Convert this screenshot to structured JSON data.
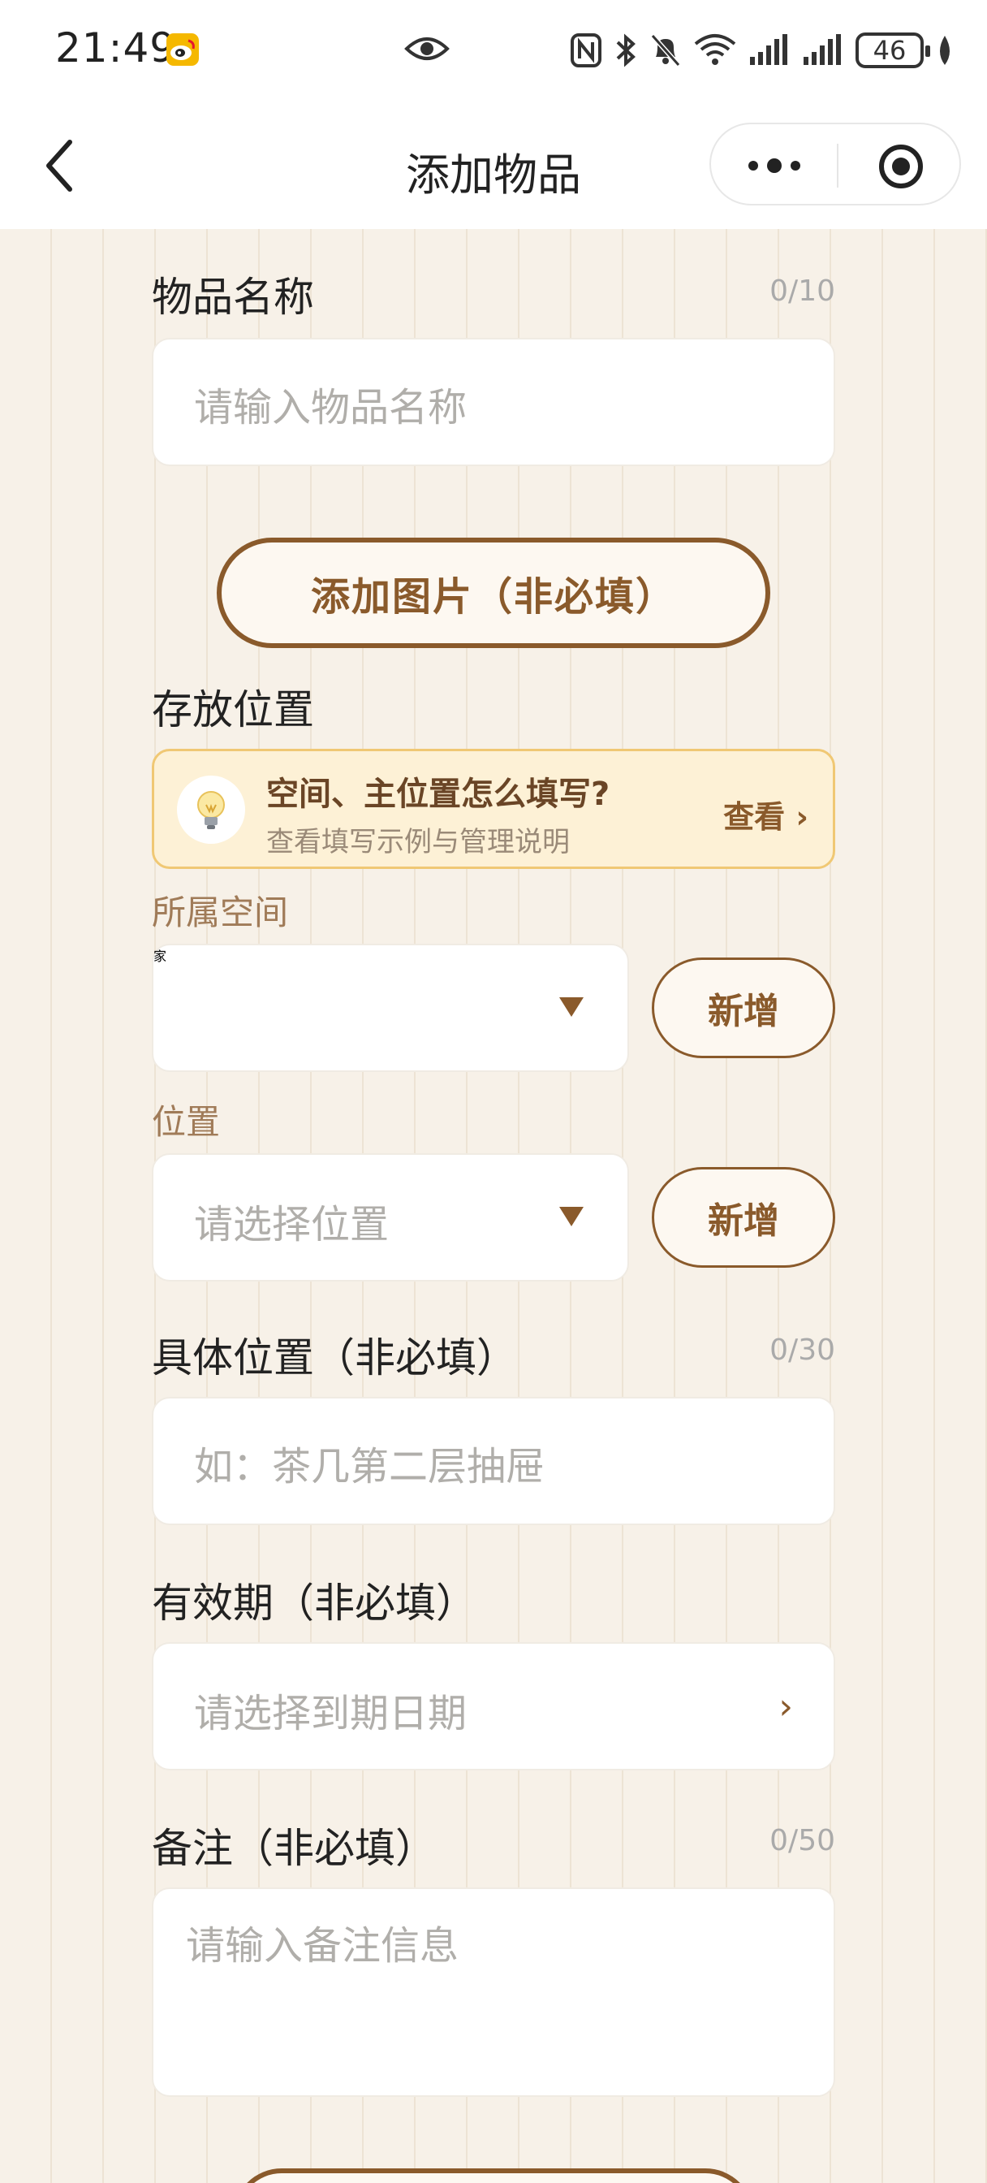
{
  "status_bar": {
    "time": "21:49",
    "battery": "46",
    "icons": [
      "weibo-icon",
      "eye-icon",
      "nfc-icon",
      "bluetooth-icon",
      "mute-icon",
      "wifi-icon",
      "signal-icon",
      "signal-icon-2",
      "leaf-icon"
    ]
  },
  "nav": {
    "title": "添加物品",
    "back_icon": "back-icon",
    "more_icon": "more-icon",
    "target_icon": "target-icon"
  },
  "form": {
    "name": {
      "label": "物品名称",
      "counter": "0/10",
      "placeholder": "请输入物品名称"
    },
    "photo_button": "添加图片（非必填）",
    "storage": {
      "label": "存放位置",
      "tip_title": "空间、主位置怎么填写?",
      "tip_desc": "查看填写示例与管理说明",
      "tip_link": "查看 ›",
      "space_label": "所属空间",
      "space_value": "家",
      "space_add": "新增",
      "location_label": "位置",
      "location_placeholder": "请选择位置",
      "location_add": "新增"
    },
    "detail": {
      "label": "具体位置（非必填）",
      "counter": "0/30",
      "placeholder": "如：茶几第二层抽屉"
    },
    "expiry": {
      "label": "有效期（非必填）",
      "placeholder": "请选择到期日期",
      "chevron": "›"
    },
    "remark": {
      "label": "备注（非必填）",
      "counter": "0/50",
      "placeholder": "请输入备注信息"
    }
  },
  "colors": {
    "accent": "#8a5a2b",
    "background": "#f7f1e8",
    "tip_bg": "#fdf1d6",
    "tip_border": "#f0c874"
  }
}
